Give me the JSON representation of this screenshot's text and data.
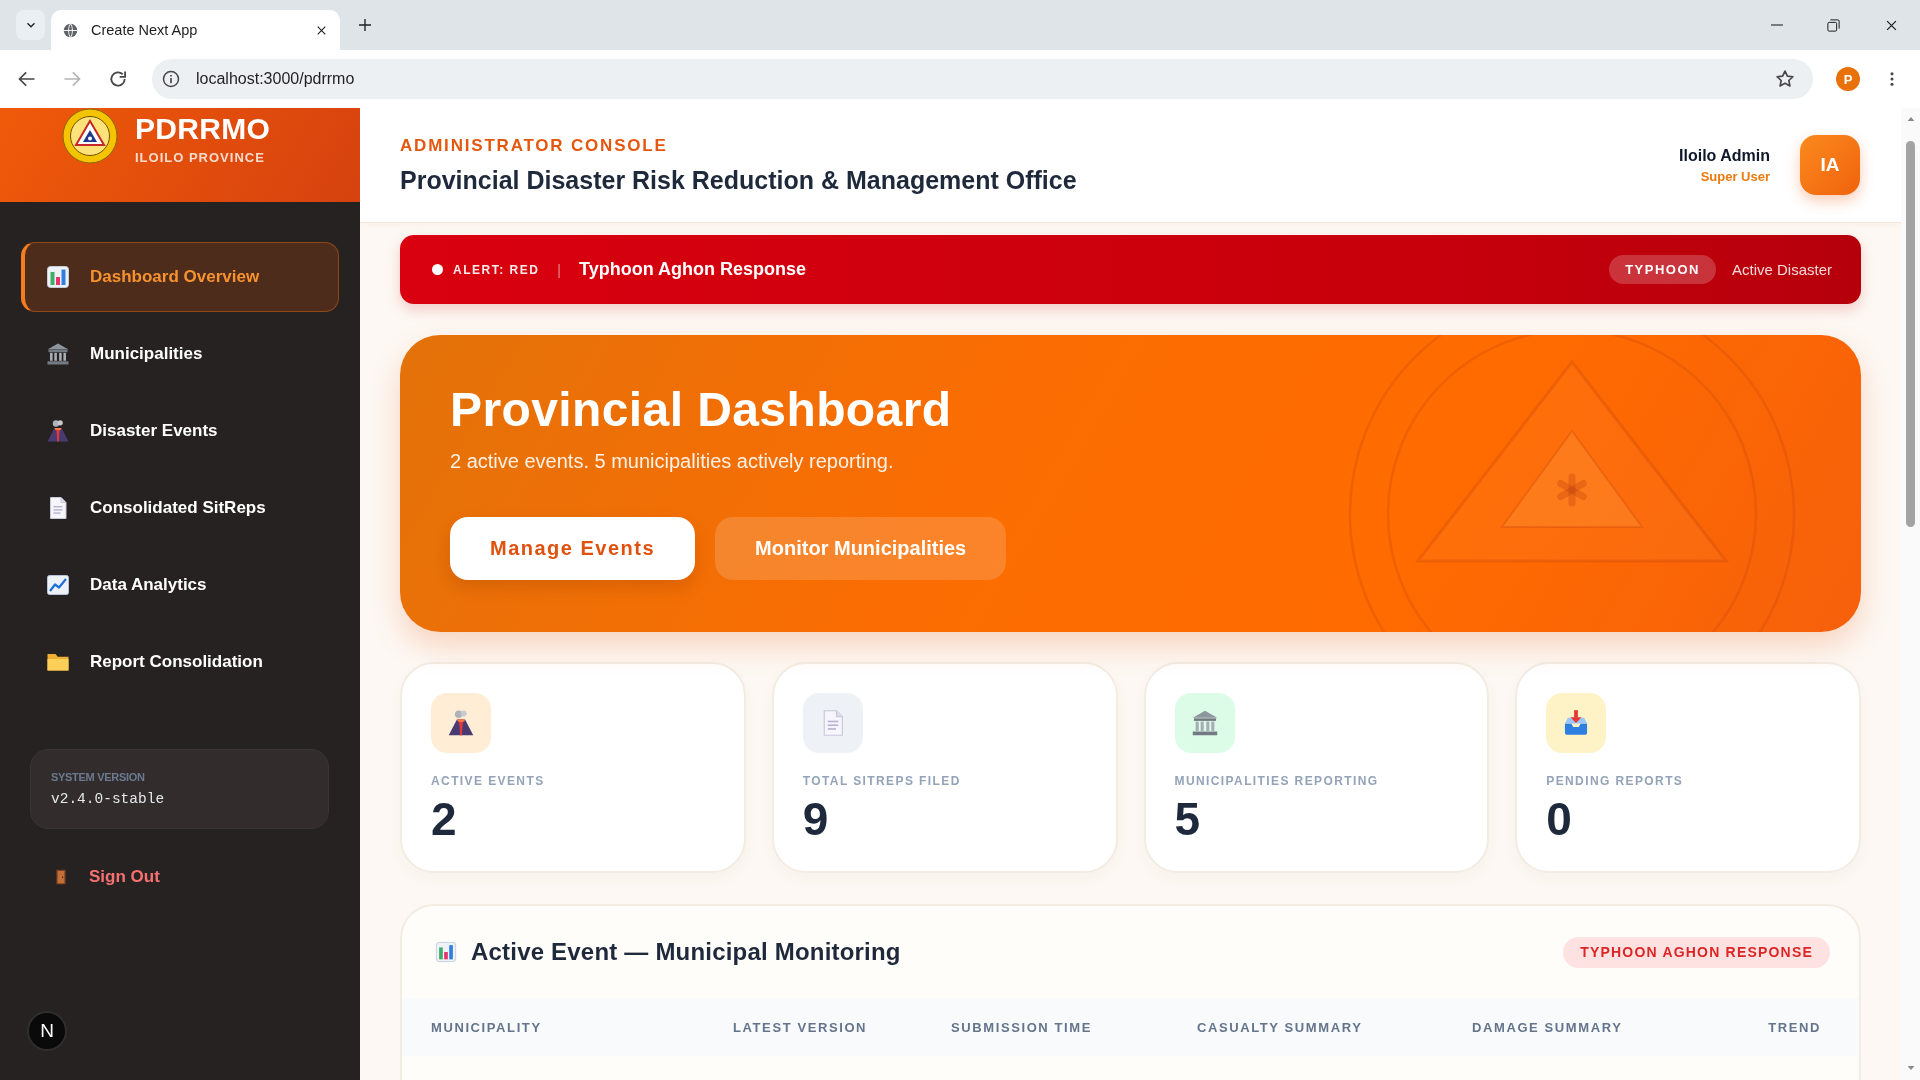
{
  "browser": {
    "tabs": [
      {
        "title": "Create Next App",
        "selected": true
      }
    ],
    "url": "localhost:3000/pdrrmo",
    "forward_disabled": true,
    "profile_initial": "P"
  },
  "sidebar": {
    "brand": "PDRRMO",
    "province": "ILOILO PROVINCE",
    "items": [
      {
        "label": "Dashboard Overview",
        "kind": "overview",
        "selected": true
      },
      {
        "label": "Municipalities",
        "kind": "municipalities",
        "selected": false
      },
      {
        "label": "Disaster Events",
        "kind": "events",
        "selected": false
      },
      {
        "label": "Consolidated SitReps",
        "kind": "sitreps",
        "selected": false
      },
      {
        "label": "Data Analytics",
        "kind": "analytics",
        "selected": false
      },
      {
        "label": "Report Consolidation",
        "kind": "reports",
        "selected": false
      }
    ],
    "version": {
      "label": "SYSTEM VERSION",
      "value": "v2.4.0-stable"
    },
    "sign_out": "Sign Out",
    "dev_badge": "N"
  },
  "header": {
    "eyebrow": "ADMINISTRATOR CONSOLE",
    "title": "Provincial Disaster Risk Reduction & Management Office",
    "user": {
      "name": "Iloilo Admin",
      "role": "Super User",
      "initials": "IA"
    }
  },
  "alert": {
    "level": "ALERT: RED",
    "separator": "|",
    "title": "Typhoon Aghon Response",
    "tag": "TYPHOON",
    "status": "Active Disaster"
  },
  "hero": {
    "title": "Provincial Dashboard",
    "subtitle": "2 active events. 5 municipalities actively reporting.",
    "buttons": [
      {
        "label": "Manage Events",
        "kind": "primary"
      },
      {
        "label": "Monitor Municipalities",
        "kind": "secondary"
      }
    ]
  },
  "stats": [
    {
      "label": "ACTIVE EVENTS",
      "value": "2",
      "kind": "events"
    },
    {
      "label": "TOTAL SITREPS FILED",
      "value": "9",
      "kind": "sitreps"
    },
    {
      "label": "MUNICIPALITIES REPORTING",
      "value": "5",
      "kind": "municipalities"
    },
    {
      "label": "PENDING REPORTS",
      "value": "0",
      "kind": "pending"
    }
  ],
  "monitoring": {
    "title": "Active Event — Municipal Monitoring",
    "badge": "TYPHOON AGHON RESPONSE",
    "columns": [
      "MUNICIPALITY",
      "LATEST VERSION",
      "SUBMISSION TIME",
      "CASUALTY SUMMARY",
      "DAMAGE SUMMARY",
      "TREND"
    ]
  }
}
